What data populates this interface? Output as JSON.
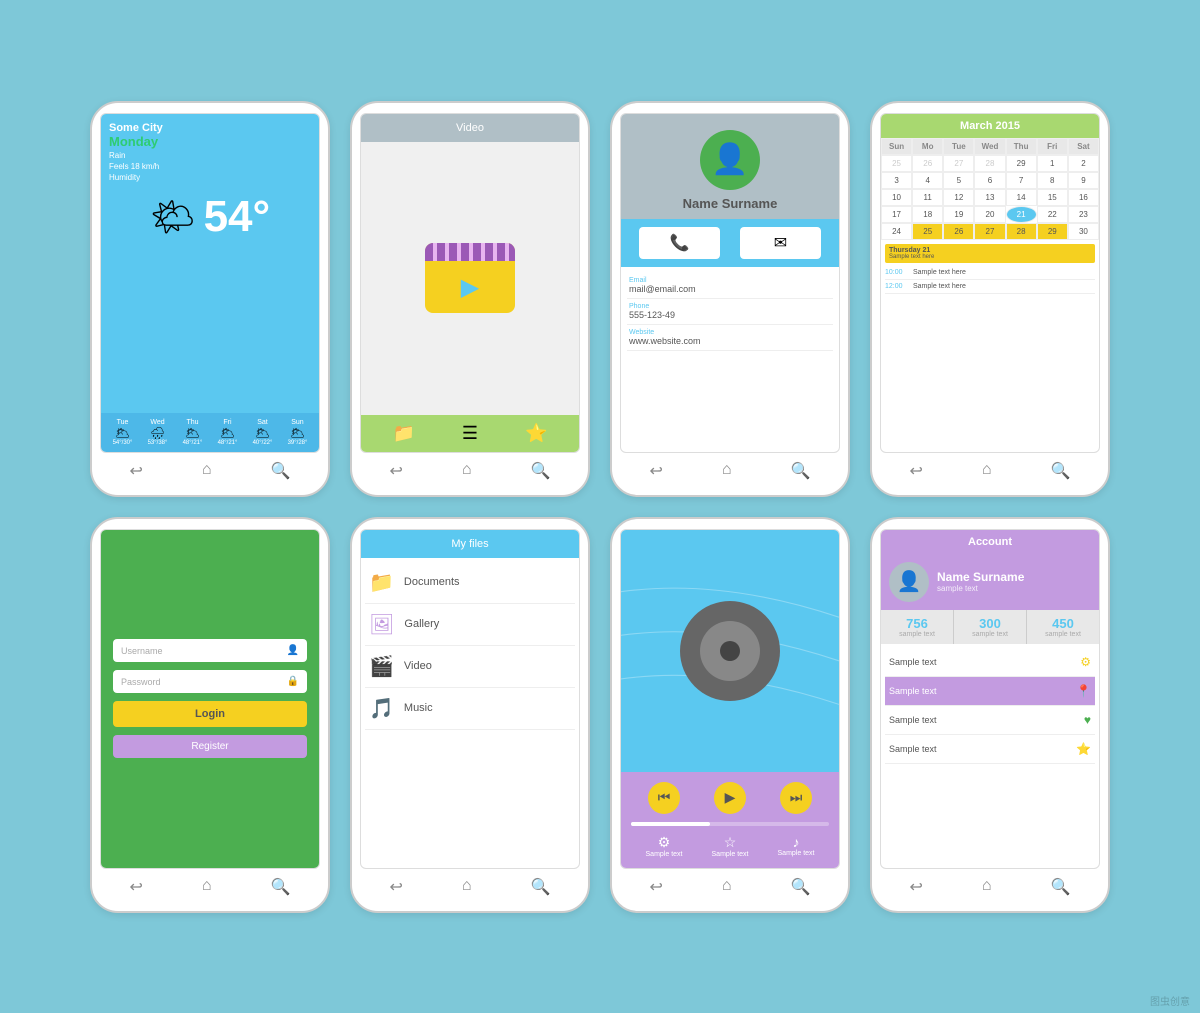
{
  "phones": [
    {
      "id": "weather",
      "label": "Weather App",
      "screen": {
        "city": "Some City",
        "day": "Monday",
        "info1": "Rain",
        "info2": "Feels 18 km/h",
        "info3": "Humidity",
        "temp": "54°",
        "forecast": [
          {
            "day": "Tue",
            "icon": "🌥",
            "temp": "54°/30°"
          },
          {
            "day": "Wed",
            "icon": "🌧",
            "temp": "53°/38°"
          },
          {
            "day": "Thu",
            "icon": "🌥",
            "temp": "48°/21°"
          },
          {
            "day": "Fri",
            "icon": "🌥",
            "temp": "48°/21°"
          },
          {
            "day": "Sat",
            "icon": "🌥",
            "temp": "40°/22°"
          },
          {
            "day": "Sun",
            "icon": "🌥",
            "temp": "39°/28°"
          }
        ]
      }
    },
    {
      "id": "video",
      "label": "Video App",
      "screen": {
        "title": "Video",
        "icons": [
          "📁",
          "☰",
          "⭐"
        ]
      }
    },
    {
      "id": "contact",
      "label": "Contact App",
      "screen": {
        "name": "Name Surname",
        "email_label": "Email",
        "email": "mail@email.com",
        "phone_label": "Phone",
        "phone": "555-123-49",
        "website_label": "Website",
        "website": "www.website.com"
      }
    },
    {
      "id": "calendar",
      "label": "Calendar App",
      "screen": {
        "title": "March 2015",
        "headers": [
          "Sun",
          "Mo",
          "Tue",
          "Wed",
          "Thu",
          "Fri",
          "Sat"
        ],
        "rows": [
          [
            "25",
            "26",
            "27",
            "28",
            "29",
            "1",
            "2"
          ],
          [
            "3",
            "4",
            "5",
            "6",
            "7",
            "8",
            "9"
          ],
          [
            "10",
            "11",
            "12",
            "13",
            "14",
            "15",
            "16"
          ],
          [
            "17",
            "18",
            "19",
            "20",
            "21",
            "22",
            "23"
          ],
          [
            "24",
            "25",
            "26",
            "27",
            "28",
            "29",
            "30"
          ]
        ],
        "today": "21",
        "today_label": "Thursday 21",
        "today_sample": "Sample text here",
        "events": [
          {
            "time": "10:00",
            "text": "Sample text here"
          },
          {
            "time": "12:00",
            "text": "Sample text here"
          }
        ]
      }
    },
    {
      "id": "login",
      "label": "Login App",
      "screen": {
        "username_placeholder": "Username",
        "password_placeholder": "Password",
        "login_btn": "Login",
        "register_btn": "Register"
      }
    },
    {
      "id": "files",
      "label": "Files App",
      "screen": {
        "title": "My files",
        "items": [
          {
            "icon": "📁",
            "name": "Documents",
            "color": "#f5d020"
          },
          {
            "icon": "🖼",
            "name": "Gallery",
            "color": "#c39be0"
          },
          {
            "icon": "🎬",
            "name": "Video",
            "color": "#4caf50"
          },
          {
            "icon": "🎵",
            "name": "Music",
            "color": "#5bc8f0"
          }
        ]
      }
    },
    {
      "id": "player",
      "label": "Music Player",
      "screen": {
        "controls": [
          "⏮",
          "▶",
          "⏭"
        ],
        "extras": [
          "⚙",
          "☆",
          "♪"
        ]
      }
    },
    {
      "id": "account",
      "label": "Account App",
      "screen": {
        "title": "Account",
        "name": "Name Surname",
        "subtitle": "sample text",
        "stats": [
          {
            "num": "756",
            "label": "sample text"
          },
          {
            "num": "300",
            "label": "sample text"
          },
          {
            "num": "450",
            "label": "sample text"
          }
        ],
        "items": [
          {
            "text": "Sample text",
            "icon": "⚙",
            "color": "#f5d020"
          },
          {
            "text": "Sample text",
            "icon": "📍",
            "color": "#f5a623"
          },
          {
            "text": "Sample text",
            "icon": "♥",
            "color": "#4caf50"
          },
          {
            "text": "Sample text",
            "icon": "⭐",
            "color": "#4caf50"
          }
        ]
      }
    }
  ],
  "nav": {
    "back": "↩",
    "home": "⌂",
    "search": "🔍"
  },
  "watermark": "图虫创意"
}
